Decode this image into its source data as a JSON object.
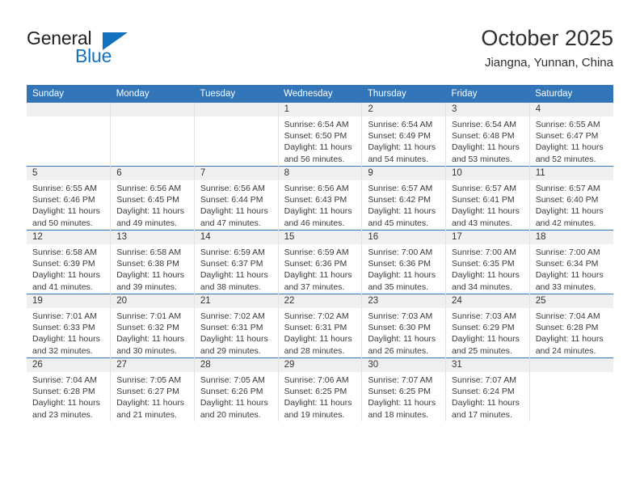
{
  "logo": {
    "word_one": "General",
    "word_two": "Blue",
    "triangle_color": "#1272c0",
    "text_color": "#231f20"
  },
  "header": {
    "month_title": "October 2025",
    "location": "Jiangna, Yunnan, China"
  },
  "theme": {
    "header_blue": "#3275b8",
    "daynum_band": "#f0f0f0",
    "grid_line": "#e3e3e3",
    "text": "#3a3a3a"
  },
  "calendar": {
    "weekday_headers": [
      "Sunday",
      "Monday",
      "Tuesday",
      "Wednesday",
      "Thursday",
      "Friday",
      "Saturday"
    ],
    "weeks": [
      [
        {
          "day": "",
          "blank": true,
          "sunrise": "",
          "sunset": "",
          "daylight_line1": "",
          "daylight_line2": ""
        },
        {
          "day": "",
          "blank": true,
          "sunrise": "",
          "sunset": "",
          "daylight_line1": "",
          "daylight_line2": ""
        },
        {
          "day": "",
          "blank": true,
          "sunrise": "",
          "sunset": "",
          "daylight_line1": "",
          "daylight_line2": ""
        },
        {
          "day": "1",
          "blank": false,
          "sunrise": "Sunrise: 6:54 AM",
          "sunset": "Sunset: 6:50 PM",
          "daylight_line1": "Daylight: 11 hours",
          "daylight_line2": "and 56 minutes."
        },
        {
          "day": "2",
          "blank": false,
          "sunrise": "Sunrise: 6:54 AM",
          "sunset": "Sunset: 6:49 PM",
          "daylight_line1": "Daylight: 11 hours",
          "daylight_line2": "and 54 minutes."
        },
        {
          "day": "3",
          "blank": false,
          "sunrise": "Sunrise: 6:54 AM",
          "sunset": "Sunset: 6:48 PM",
          "daylight_line1": "Daylight: 11 hours",
          "daylight_line2": "and 53 minutes."
        },
        {
          "day": "4",
          "blank": false,
          "sunrise": "Sunrise: 6:55 AM",
          "sunset": "Sunset: 6:47 PM",
          "daylight_line1": "Daylight: 11 hours",
          "daylight_line2": "and 52 minutes."
        }
      ],
      [
        {
          "day": "5",
          "blank": false,
          "sunrise": "Sunrise: 6:55 AM",
          "sunset": "Sunset: 6:46 PM",
          "daylight_line1": "Daylight: 11 hours",
          "daylight_line2": "and 50 minutes."
        },
        {
          "day": "6",
          "blank": false,
          "sunrise": "Sunrise: 6:56 AM",
          "sunset": "Sunset: 6:45 PM",
          "daylight_line1": "Daylight: 11 hours",
          "daylight_line2": "and 49 minutes."
        },
        {
          "day": "7",
          "blank": false,
          "sunrise": "Sunrise: 6:56 AM",
          "sunset": "Sunset: 6:44 PM",
          "daylight_line1": "Daylight: 11 hours",
          "daylight_line2": "and 47 minutes."
        },
        {
          "day": "8",
          "blank": false,
          "sunrise": "Sunrise: 6:56 AM",
          "sunset": "Sunset: 6:43 PM",
          "daylight_line1": "Daylight: 11 hours",
          "daylight_line2": "and 46 minutes."
        },
        {
          "day": "9",
          "blank": false,
          "sunrise": "Sunrise: 6:57 AM",
          "sunset": "Sunset: 6:42 PM",
          "daylight_line1": "Daylight: 11 hours",
          "daylight_line2": "and 45 minutes."
        },
        {
          "day": "10",
          "blank": false,
          "sunrise": "Sunrise: 6:57 AM",
          "sunset": "Sunset: 6:41 PM",
          "daylight_line1": "Daylight: 11 hours",
          "daylight_line2": "and 43 minutes."
        },
        {
          "day": "11",
          "blank": false,
          "sunrise": "Sunrise: 6:57 AM",
          "sunset": "Sunset: 6:40 PM",
          "daylight_line1": "Daylight: 11 hours",
          "daylight_line2": "and 42 minutes."
        }
      ],
      [
        {
          "day": "12",
          "blank": false,
          "sunrise": "Sunrise: 6:58 AM",
          "sunset": "Sunset: 6:39 PM",
          "daylight_line1": "Daylight: 11 hours",
          "daylight_line2": "and 41 minutes."
        },
        {
          "day": "13",
          "blank": false,
          "sunrise": "Sunrise: 6:58 AM",
          "sunset": "Sunset: 6:38 PM",
          "daylight_line1": "Daylight: 11 hours",
          "daylight_line2": "and 39 minutes."
        },
        {
          "day": "14",
          "blank": false,
          "sunrise": "Sunrise: 6:59 AM",
          "sunset": "Sunset: 6:37 PM",
          "daylight_line1": "Daylight: 11 hours",
          "daylight_line2": "and 38 minutes."
        },
        {
          "day": "15",
          "blank": false,
          "sunrise": "Sunrise: 6:59 AM",
          "sunset": "Sunset: 6:36 PM",
          "daylight_line1": "Daylight: 11 hours",
          "daylight_line2": "and 37 minutes."
        },
        {
          "day": "16",
          "blank": false,
          "sunrise": "Sunrise: 7:00 AM",
          "sunset": "Sunset: 6:36 PM",
          "daylight_line1": "Daylight: 11 hours",
          "daylight_line2": "and 35 minutes."
        },
        {
          "day": "17",
          "blank": false,
          "sunrise": "Sunrise: 7:00 AM",
          "sunset": "Sunset: 6:35 PM",
          "daylight_line1": "Daylight: 11 hours",
          "daylight_line2": "and 34 minutes."
        },
        {
          "day": "18",
          "blank": false,
          "sunrise": "Sunrise: 7:00 AM",
          "sunset": "Sunset: 6:34 PM",
          "daylight_line1": "Daylight: 11 hours",
          "daylight_line2": "and 33 minutes."
        }
      ],
      [
        {
          "day": "19",
          "blank": false,
          "sunrise": "Sunrise: 7:01 AM",
          "sunset": "Sunset: 6:33 PM",
          "daylight_line1": "Daylight: 11 hours",
          "daylight_line2": "and 32 minutes."
        },
        {
          "day": "20",
          "blank": false,
          "sunrise": "Sunrise: 7:01 AM",
          "sunset": "Sunset: 6:32 PM",
          "daylight_line1": "Daylight: 11 hours",
          "daylight_line2": "and 30 minutes."
        },
        {
          "day": "21",
          "blank": false,
          "sunrise": "Sunrise: 7:02 AM",
          "sunset": "Sunset: 6:31 PM",
          "daylight_line1": "Daylight: 11 hours",
          "daylight_line2": "and 29 minutes."
        },
        {
          "day": "22",
          "blank": false,
          "sunrise": "Sunrise: 7:02 AM",
          "sunset": "Sunset: 6:31 PM",
          "daylight_line1": "Daylight: 11 hours",
          "daylight_line2": "and 28 minutes."
        },
        {
          "day": "23",
          "blank": false,
          "sunrise": "Sunrise: 7:03 AM",
          "sunset": "Sunset: 6:30 PM",
          "daylight_line1": "Daylight: 11 hours",
          "daylight_line2": "and 26 minutes."
        },
        {
          "day": "24",
          "blank": false,
          "sunrise": "Sunrise: 7:03 AM",
          "sunset": "Sunset: 6:29 PM",
          "daylight_line1": "Daylight: 11 hours",
          "daylight_line2": "and 25 minutes."
        },
        {
          "day": "25",
          "blank": false,
          "sunrise": "Sunrise: 7:04 AM",
          "sunset": "Sunset: 6:28 PM",
          "daylight_line1": "Daylight: 11 hours",
          "daylight_line2": "and 24 minutes."
        }
      ],
      [
        {
          "day": "26",
          "blank": false,
          "sunrise": "Sunrise: 7:04 AM",
          "sunset": "Sunset: 6:28 PM",
          "daylight_line1": "Daylight: 11 hours",
          "daylight_line2": "and 23 minutes."
        },
        {
          "day": "27",
          "blank": false,
          "sunrise": "Sunrise: 7:05 AM",
          "sunset": "Sunset: 6:27 PM",
          "daylight_line1": "Daylight: 11 hours",
          "daylight_line2": "and 21 minutes."
        },
        {
          "day": "28",
          "blank": false,
          "sunrise": "Sunrise: 7:05 AM",
          "sunset": "Sunset: 6:26 PM",
          "daylight_line1": "Daylight: 11 hours",
          "daylight_line2": "and 20 minutes."
        },
        {
          "day": "29",
          "blank": false,
          "sunrise": "Sunrise: 7:06 AM",
          "sunset": "Sunset: 6:25 PM",
          "daylight_line1": "Daylight: 11 hours",
          "daylight_line2": "and 19 minutes."
        },
        {
          "day": "30",
          "blank": false,
          "sunrise": "Sunrise: 7:07 AM",
          "sunset": "Sunset: 6:25 PM",
          "daylight_line1": "Daylight: 11 hours",
          "daylight_line2": "and 18 minutes."
        },
        {
          "day": "31",
          "blank": false,
          "sunrise": "Sunrise: 7:07 AM",
          "sunset": "Sunset: 6:24 PM",
          "daylight_line1": "Daylight: 11 hours",
          "daylight_line2": "and 17 minutes."
        },
        {
          "day": "",
          "blank": true,
          "sunrise": "",
          "sunset": "",
          "daylight_line1": "",
          "daylight_line2": ""
        }
      ]
    ]
  }
}
